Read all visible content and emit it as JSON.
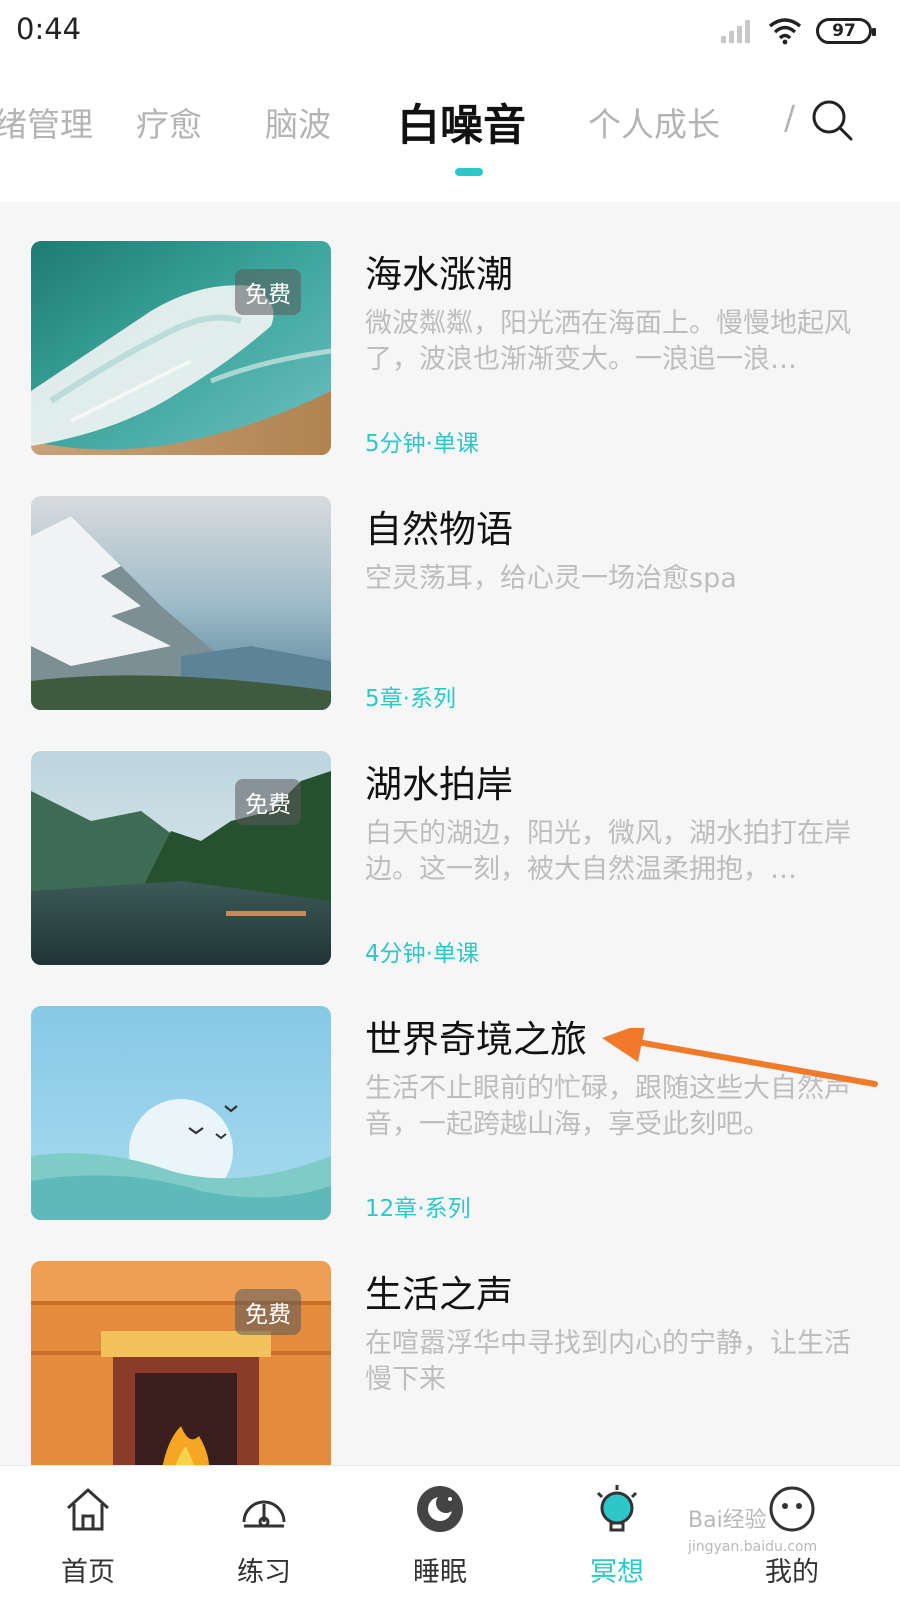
{
  "status_bar": {
    "time": "0:44",
    "battery": "97",
    "icons": [
      "signal-icon",
      "wifi-icon",
      "battery-icon"
    ]
  },
  "tabs": [
    {
      "label": "绪管理"
    },
    {
      "label": "疗愈"
    },
    {
      "label": "脑波"
    },
    {
      "label": "白噪音"
    },
    {
      "label": "个人成长"
    },
    {
      "label": "/"
    }
  ],
  "active_tab": "白噪音",
  "colors": {
    "accent": "#2ec7c9",
    "arrow": "#f07a2a"
  },
  "items": [
    {
      "title": "海水涨潮",
      "description": "微波粼粼，阳光洒在海面上。慢慢地起风了，波浪也渐渐变大。一浪追一浪…",
      "meta": "5分钟·单课",
      "badge": "免费"
    },
    {
      "title": "自然物语",
      "description": "空灵荡耳，给心灵一场治愈spa",
      "meta": "5章·系列",
      "badge": ""
    },
    {
      "title": "湖水拍岸",
      "description": "白天的湖边，阳光，微风，湖水拍打在岸边。这一刻，被大自然温柔拥抱，…",
      "meta": "4分钟·单课",
      "badge": "免费"
    },
    {
      "title": "世界奇境之旅",
      "description": "生活不止眼前的忙碌，跟随这些大自然声音，一起跨越山海，享受此刻吧。",
      "meta": "12章·系列",
      "badge": ""
    },
    {
      "title": "生活之声",
      "description": "在喧嚣浮华中寻找到内心的宁静，让生活慢下来",
      "meta": "",
      "badge": "免费"
    }
  ],
  "bottom_nav": [
    {
      "label": "首页",
      "icon": "home-icon"
    },
    {
      "label": "练习",
      "icon": "gauge-icon"
    },
    {
      "label": "睡眠",
      "icon": "moon-icon"
    },
    {
      "label": "冥想",
      "icon": "lightbulb-icon"
    },
    {
      "label": "我的",
      "icon": "face-icon"
    }
  ],
  "active_nav": "冥想",
  "watermark": {
    "line1": "Bai经验",
    "line2": "jingyan.baidu.com"
  }
}
